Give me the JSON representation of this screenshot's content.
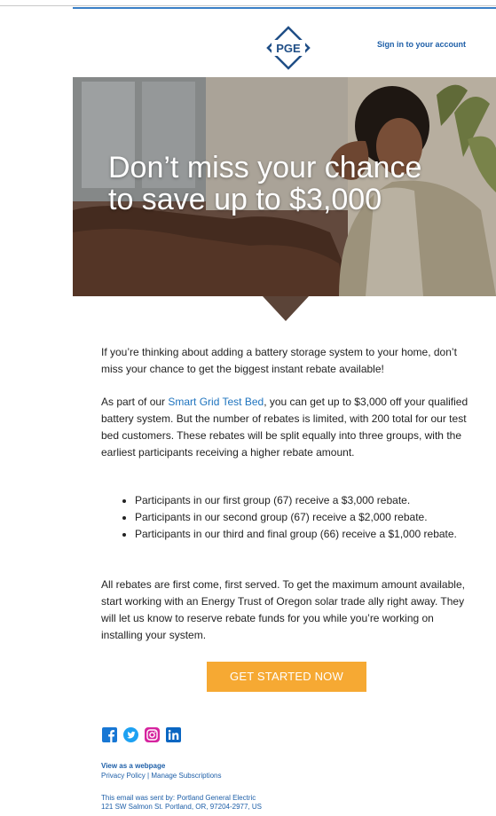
{
  "header": {
    "logo_text": "PGE",
    "signin_label": "Sign in to your account"
  },
  "hero": {
    "title_line1": "Don’t miss your chance",
    "title_line2": "to save up to $3,000"
  },
  "body": {
    "p1": "If you’re thinking about adding a battery storage system to your home, don’t miss your chance to get the biggest instant rebate available!",
    "p2_before": "As part of our ",
    "p2_link": "Smart Grid Test Bed",
    "p2_after": ", you can get up to $3,000 off your qualified battery system. But the number of rebates is limited, with 200 total for our test bed customers. These rebates will be split equally into three groups, with the earliest participants receiving a higher rebate amount.",
    "bullets": [
      "Participants in our first group (67) receive a $3,000 rebate.",
      "Participants in our second group (67) receive a $2,000 rebate.",
      "Participants in our third and final group (66) receive a $1,000 rebate."
    ],
    "p3": "All rebates are first come, first served. To get the maximum amount available, start working with an Energy Trust of Oregon solar trade ally right away. They will let us know to reserve rebate funds for you while you’re working on installing your system."
  },
  "cta": {
    "label": "GET STARTED NOW"
  },
  "social": {
    "icons": [
      "facebook-icon",
      "twitter-icon",
      "instagram-icon",
      "linkedin-icon"
    ]
  },
  "footer": {
    "view_webpage": "View as a webpage",
    "privacy": "Privacy Policy",
    "separator": "|",
    "manage": "Manage Subscriptions",
    "sent_by": "This email was sent by: Portland General Electric",
    "address": "121 SW Salmon St. Portland, OR, 97204-2977, US"
  },
  "colors": {
    "brand_blue": "#1e5fa8",
    "cta_orange": "#f6a933",
    "link_blue": "#1e73be"
  }
}
